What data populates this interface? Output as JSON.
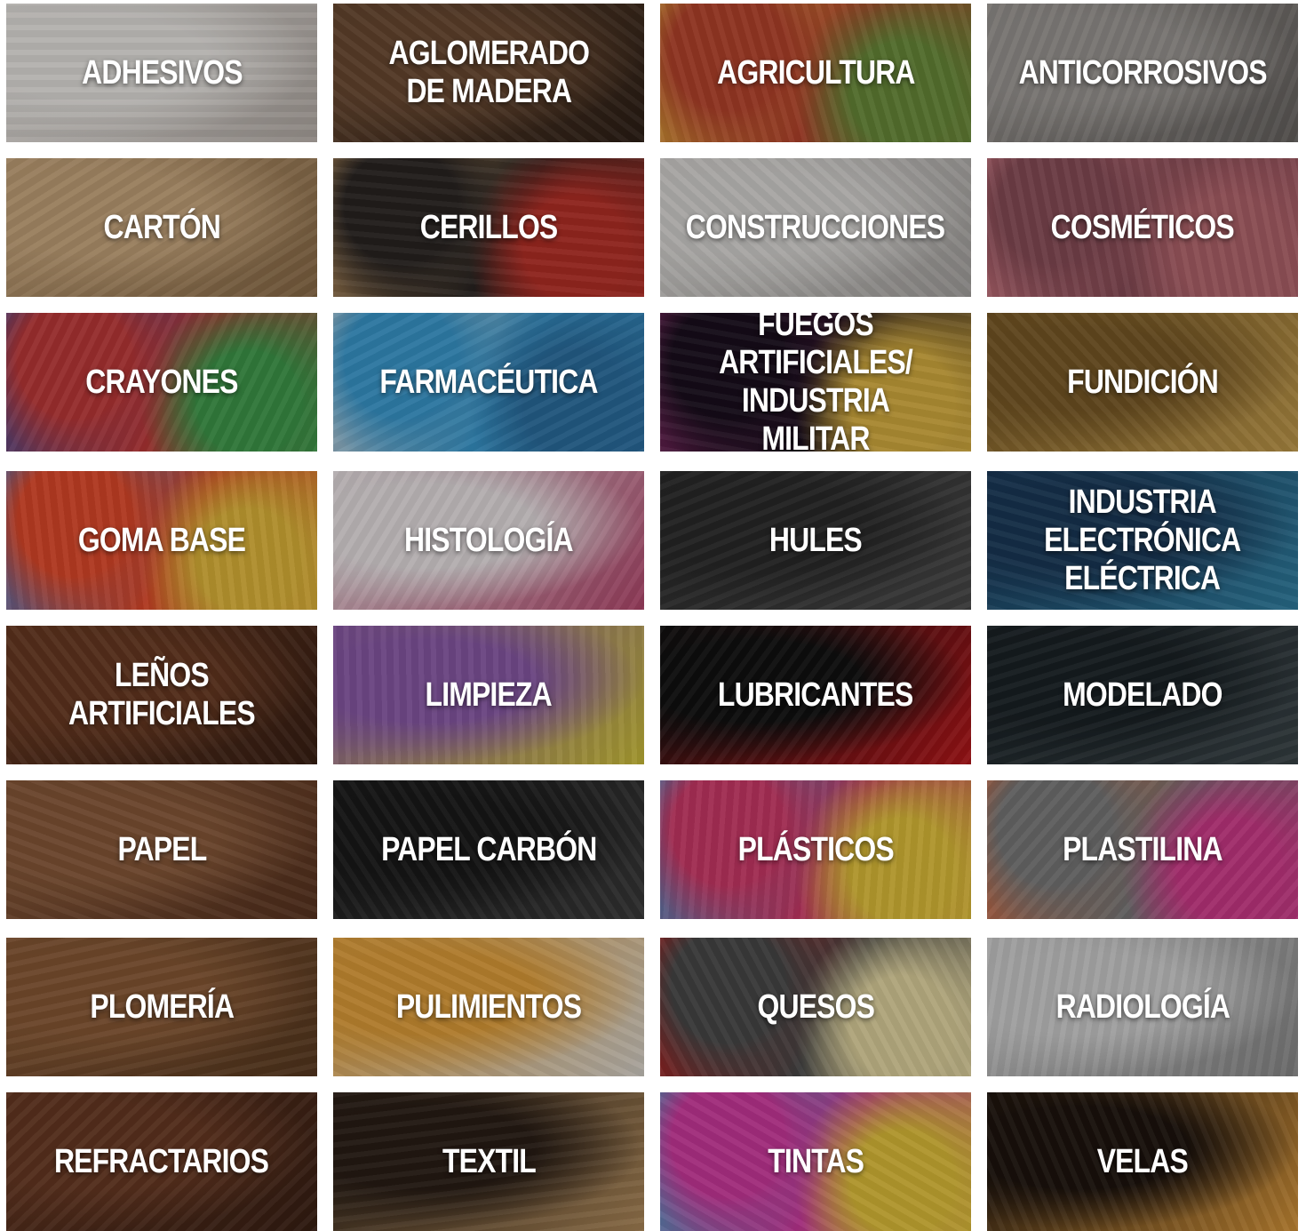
{
  "industries": [
    {
      "name": "ADHESIVOS",
      "icon": "adhesive-image",
      "colors": [
        "#e9e6e2",
        "#b6aea8"
      ]
    },
    {
      "name": "AGLOMERADO\nDE MADERA",
      "icon": "particle-board-image",
      "colors": [
        "#6b4a32",
        "#2d1f16"
      ]
    },
    {
      "name": "AGRICULTURA",
      "icon": "produce-image",
      "colors": [
        "#b8432c",
        "#e3b43c",
        "#6a8c3a"
      ]
    },
    {
      "name": "ANTICORROSIVOS",
      "icon": "chain-image",
      "colors": [
        "#9c9894",
        "#676360"
      ]
    },
    {
      "name": "CARTÓN",
      "icon": "cardboard-image",
      "colors": [
        "#c6a47a",
        "#8a6b47"
      ]
    },
    {
      "name": "CERILLOS",
      "icon": "matches-image",
      "colors": [
        "#2a2523",
        "#c79a63",
        "#b82f26"
      ]
    },
    {
      "name": "CONSTRUCCIONES",
      "icon": "drywall-image",
      "colors": [
        "#d9d7d4",
        "#a8a5a2"
      ]
    },
    {
      "name": "COSMÉTICOS",
      "icon": "makeup-image",
      "colors": [
        "#8a4d58",
        "#d77b86",
        "#b3646c"
      ]
    },
    {
      "name": "CRAYONES",
      "icon": "crayons-image",
      "colors": [
        "#c23a3a",
        "#3a4fa0",
        "#3e9a4b"
      ]
    },
    {
      "name": "FARMACÉUTICA",
      "icon": "pills-image",
      "colors": [
        "#3a9ad0",
        "#d9d9d9",
        "#2a6fa1"
      ]
    },
    {
      "name": "FUEGOS ARTIFICIALES/\nINDUSTRIA MILITAR",
      "icon": "fireworks-image",
      "colors": [
        "#1a0f1e",
        "#8a2a6a",
        "#d9b040"
      ]
    },
    {
      "name": "FUNDICIÓN",
      "icon": "gold-ring-image",
      "colors": [
        "#7a5a26",
        "#c19a4a"
      ]
    },
    {
      "name": "GOMA BASE",
      "icon": "gumballs-image",
      "colors": [
        "#e34a2a",
        "#3a7ad0",
        "#e3b83a"
      ]
    },
    {
      "name": "HISTOLOGÍA",
      "icon": "stained-tissue-image",
      "colors": [
        "#e9e2e4",
        "#b5486e"
      ]
    },
    {
      "name": "HULES",
      "icon": "tires-image",
      "colors": [
        "#2a2a2a",
        "#4a4a4a"
      ]
    },
    {
      "name": "INDUSTRIA\nELECTRÓNICA\nELÉCTRICA",
      "icon": "circuit-board-image",
      "colors": [
        "#1a3a5a",
        "#2f7fa2"
      ]
    },
    {
      "name": "LEÑOS\nARTIFICIALES",
      "icon": "logs-image",
      "colors": [
        "#6a3a22",
        "#3a2014"
      ]
    },
    {
      "name": "LIMPIEZA",
      "icon": "cleaning-products-image",
      "colors": [
        "#8a5aa8",
        "#d0c23a"
      ]
    },
    {
      "name": "LUBRICANTES",
      "icon": "oil-can-gears-image",
      "colors": [
        "#111111",
        "#b8161a"
      ]
    },
    {
      "name": "MODELADO",
      "icon": "mannequin-image",
      "colors": [
        "#1a2226",
        "#3a4448"
      ]
    },
    {
      "name": "PAPEL",
      "icon": "paper-image",
      "colors": [
        "#8a5a3a",
        "#5a3420"
      ]
    },
    {
      "name": "PAPEL CARBÓN",
      "icon": "sandpaper-image",
      "colors": [
        "#1a1a1a",
        "#3a3a3a"
      ]
    },
    {
      "name": "PLÁSTICOS",
      "icon": "straws-image",
      "colors": [
        "#d03a6a",
        "#3a9ad0",
        "#e3c23a"
      ]
    },
    {
      "name": "PLASTILINA",
      "icon": "clay-figures-image",
      "colors": [
        "#7a7a7a",
        "#e36a3a",
        "#d03a8a"
      ]
    },
    {
      "name": "PLOMERÍA",
      "icon": "pipe-image",
      "colors": [
        "#8a5a36",
        "#5a3a20"
      ]
    },
    {
      "name": "PULIMIENTOS",
      "icon": "polish-cloth-image",
      "colors": [
        "#e3a03a",
        "#d9d4cc"
      ]
    },
    {
      "name": "QUESOS",
      "icon": "cheese-image",
      "colors": [
        "#4a4a4a",
        "#c21a1a",
        "#e3d6a0"
      ]
    },
    {
      "name": "RADIOLOGÍA",
      "icon": "ct-scanner-image",
      "colors": [
        "#cfcfcf",
        "#8a8a8a"
      ]
    },
    {
      "name": "REFRACTARIOS",
      "icon": "kiln-image",
      "colors": [
        "#6a3a24",
        "#3a2014"
      ]
    },
    {
      "name": "TEXTIL",
      "icon": "brush-fibers-image",
      "colors": [
        "#2a1e16",
        "#b08a5a"
      ]
    },
    {
      "name": "TINTAS",
      "icon": "paint-splash-image",
      "colors": [
        "#d03aa0",
        "#3ab0d0",
        "#e3c23a"
      ]
    },
    {
      "name": "VELAS",
      "icon": "candles-image",
      "colors": [
        "#1e140e",
        "#d8963a"
      ]
    }
  ]
}
